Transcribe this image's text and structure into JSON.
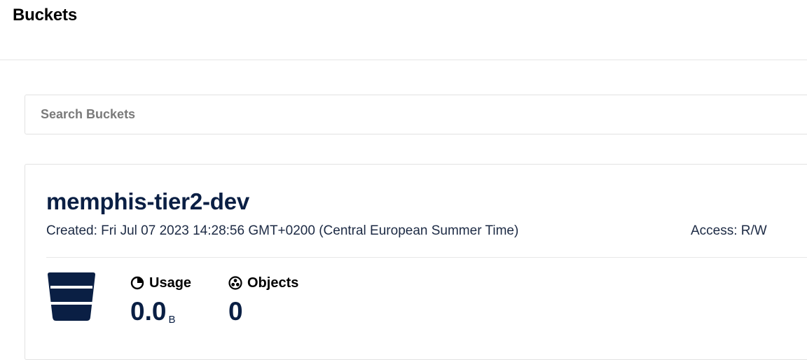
{
  "page": {
    "title": "Buckets"
  },
  "search": {
    "placeholder": "Search Buckets",
    "value": ""
  },
  "bucket": {
    "name": "memphis-tier2-dev",
    "created": "Created: Fri Jul 07 2023 14:28:56 GMT+0200 (Central European Summer Time)",
    "access": "Access: R/W",
    "icon": "bucket-icon",
    "usage": {
      "label": "Usage",
      "value": "0.0",
      "unit": "B",
      "icon": "pie-chart-icon"
    },
    "objects": {
      "label": "Objects",
      "value": "0",
      "icon": "objects-icon"
    }
  },
  "colors": {
    "brand_navy": "#0a1f44",
    "border": "#e2e2e2",
    "placeholder": "#7a7a7a"
  }
}
